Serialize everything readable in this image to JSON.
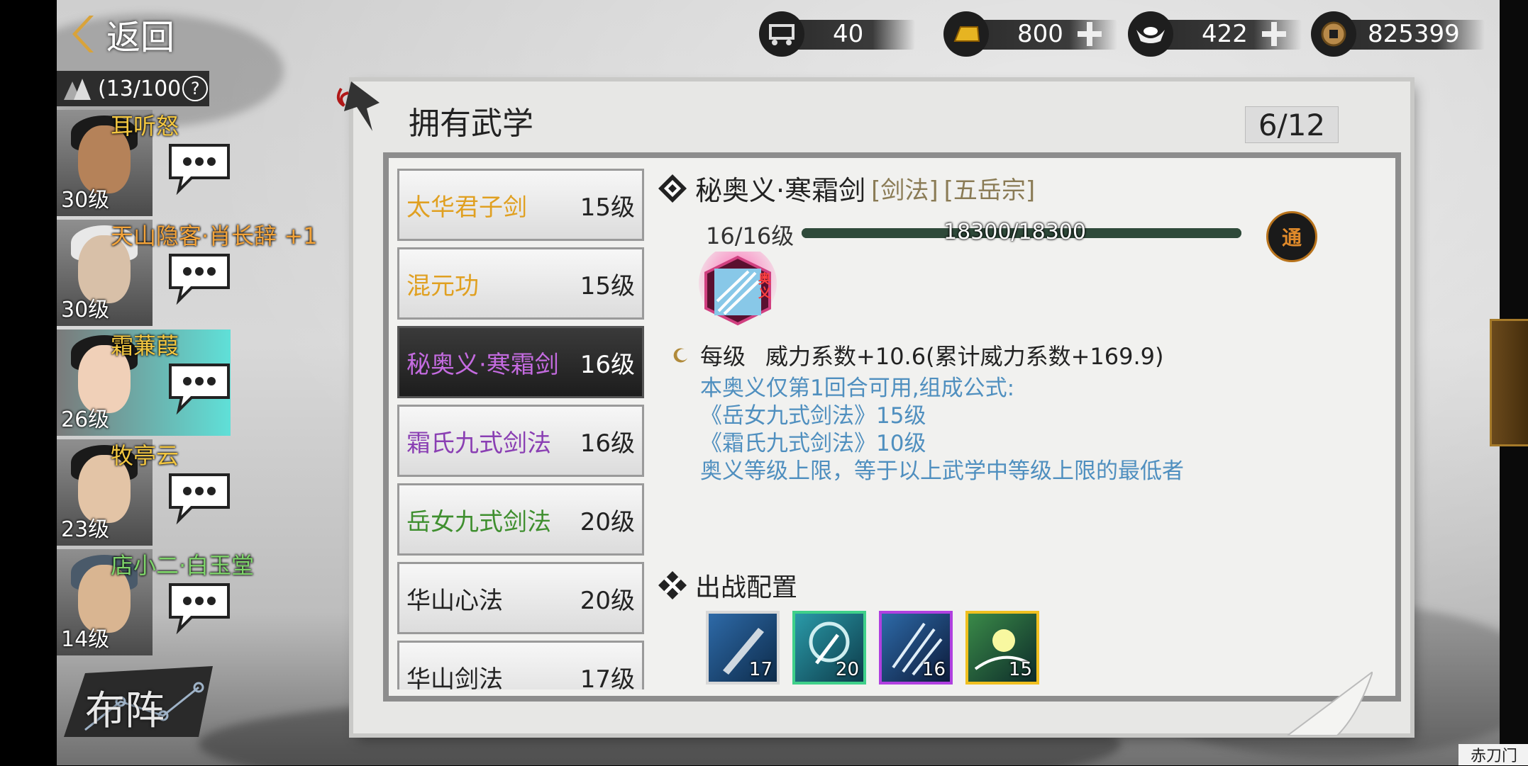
{
  "topbar": {
    "back_label": "返回",
    "resources": [
      {
        "icon": "cart-icon",
        "value": "40",
        "has_plus": false
      },
      {
        "icon": "gold-bar-icon",
        "value": "800",
        "has_plus": true
      },
      {
        "icon": "silver-ingot-icon",
        "value": "422",
        "has_plus": true
      },
      {
        "icon": "copper-coin-icon",
        "value": "825399",
        "has_plus": false
      }
    ]
  },
  "roster": {
    "count": "(13/100",
    "heroes": [
      {
        "name": "耳听怒",
        "level": "30级",
        "name_color": "#f2c640"
      },
      {
        "name": "天山隐客·肖长辞 +1",
        "level": "30级",
        "name_color": "#f2a33a"
      },
      {
        "name": "霜蒹葭",
        "level": "26级",
        "name_color": "#f2c640"
      },
      {
        "name": "牧亭云",
        "level": "23级",
        "name_color": "#f2c640"
      },
      {
        "name": "店小二·白玉堂",
        "level": "14级",
        "name_color": "#7ed46a"
      }
    ],
    "formation_label": "布阵"
  },
  "panel": {
    "title": "拥有武学",
    "counter": "6/12",
    "martial_arts": [
      {
        "name": "太华君子剑",
        "level": "15级",
        "color": "#e0a021"
      },
      {
        "name": "混元功",
        "level": "15级",
        "color": "#e0a021"
      },
      {
        "name": "秘奥义·寒霜剑",
        "level": "16级",
        "color": "#c46be0",
        "selected": true
      },
      {
        "name": "霜氏九式剑法",
        "level": "16级",
        "color": "#8a3fb3"
      },
      {
        "name": "岳女九式剑法",
        "level": "20级",
        "color": "#3f8f2f"
      },
      {
        "name": "华山心法",
        "level": "20级",
        "color": "#222222"
      },
      {
        "name": "华山剑法",
        "level": "17级",
        "color": "#222222"
      }
    ]
  },
  "detail": {
    "name": "秘奥义·寒霜剑",
    "tag_type": "[剑法]",
    "tag_sect": "[五岳宗]",
    "level_text": "16/16级",
    "exp_text": "18300/18300",
    "exp_fraction": 1.0,
    "badge": "通",
    "skill_badge": "奥义",
    "effect_prefix": "每级",
    "effect_text": "威力系数+10.6(累计威力系数+169.9)",
    "desc_lines": [
      "本奥义仅第1回合可用,组成公式:",
      "《岳女九式剑法》15级",
      "《霜氏九式剑法》10级",
      "奥义等级上限，等于以上武学中等级上限的最低者"
    ]
  },
  "deploy": {
    "title": "出战配置",
    "skills": [
      {
        "level": "17",
        "border": "#d8d8d8"
      },
      {
        "level": "20",
        "border": "#3fd08a"
      },
      {
        "level": "16",
        "border": "#b040e0"
      },
      {
        "level": "15",
        "border": "#f0c020"
      }
    ]
  },
  "sect_label": "赤刀门"
}
